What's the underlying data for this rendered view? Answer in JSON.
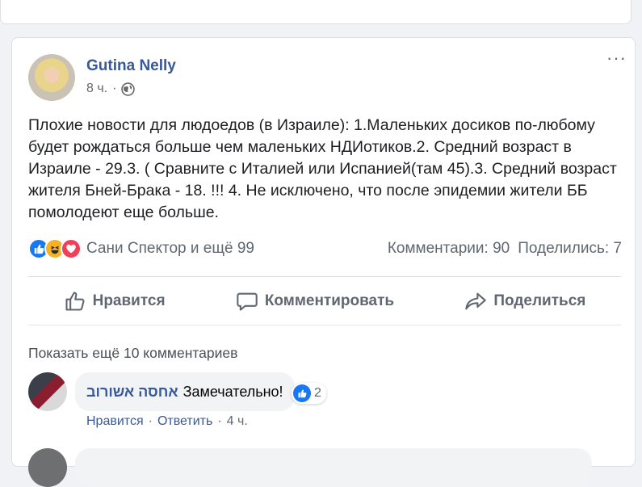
{
  "post": {
    "author": "Gutina Nelly",
    "time": "8 ч.",
    "separator": "·",
    "text": "Плохие новости для людоедов (в Израиле): 1.Маленьких досиков по-любому будет рождаться больше чем маленьких НДИотиков.2. Средний возраст в Израиле - 29.3. ( Сравните с Италией или Испанией(там 45).3. Средний возраст жителя Бней-Брака - 18. !!! 4. Не исключено, что после эпидемии жители ББ помолодеют еще больше.",
    "more_icon": "···"
  },
  "reactions": {
    "icons": [
      "like-icon",
      "haha-icon",
      "love-icon"
    ],
    "names": "Сани Спектор и ещё 99",
    "comments": "Комментарии: 90",
    "shares": "Поделились: 7"
  },
  "actions": {
    "like": "Нравится",
    "comment": "Комментировать",
    "share": "Поделиться"
  },
  "comments": {
    "show_more": "Показать ещё 10 комментариев",
    "items": [
      {
        "author": "אחסה אשורוב",
        "text": "Замечательно!",
        "likes": "2",
        "like_label": "Нравится",
        "reply_label": "Ответить",
        "time": "4 ч."
      }
    ]
  },
  "colors": {
    "link": "#385898",
    "like": "#1877f2",
    "haha": "#f7b125",
    "love": "#f33e58"
  }
}
